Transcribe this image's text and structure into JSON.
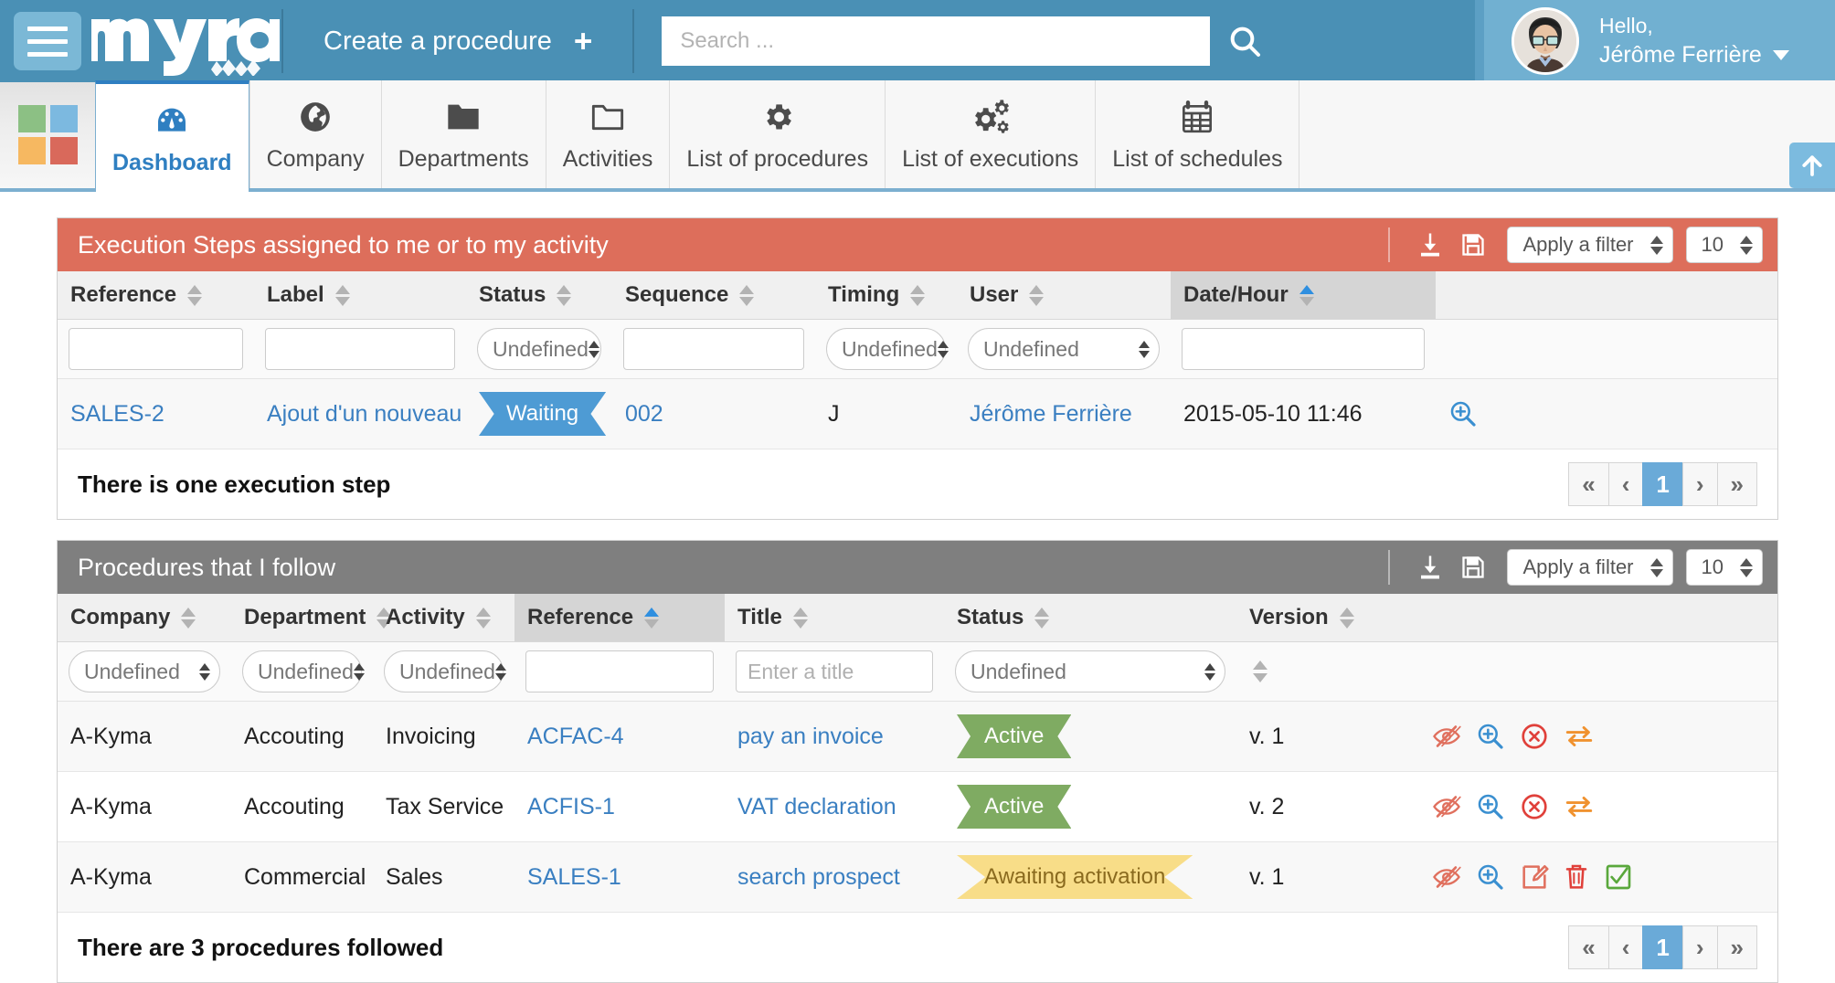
{
  "brand": {
    "name": "myra",
    "logo_squares": [
      "#8cc084",
      "#7cb9e0",
      "#f6b861",
      "#d9695b"
    ]
  },
  "topbar": {
    "menu_icon": "hamburger-icon",
    "create_label": "Create a procedure",
    "create_plus": "+",
    "search_placeholder": "Search ...",
    "search_value": "",
    "search_icon": "search-icon",
    "greeting": "Hello,",
    "user_name": "Jérôme Ferrière",
    "accent": "#4a90b5"
  },
  "nav": {
    "tabs": [
      {
        "label": "Dashboard",
        "icon": "dashboard-gauge-icon",
        "active": true
      },
      {
        "label": "Company",
        "icon": "globe-icon",
        "active": false
      },
      {
        "label": "Departments",
        "icon": "folder-filled-icon",
        "active": false
      },
      {
        "label": "Activities",
        "icon": "folder-outline-icon",
        "active": false
      },
      {
        "label": "List of procedures",
        "icon": "gear-icon",
        "active": false
      },
      {
        "label": "List of executions",
        "icon": "gears-icon",
        "active": false
      },
      {
        "label": "List of schedules",
        "icon": "calendar-icon",
        "active": false
      }
    ],
    "scroll_top_icon": "arrow-up-icon"
  },
  "panel1": {
    "title": "Execution Steps assigned to me or to my activity",
    "header_color": "#dd6e5b",
    "tools": {
      "export_icon": "download-icon",
      "save_icon": "floppy-save-icon",
      "filter_label": "Apply a filter",
      "page_size": "10"
    },
    "columns": [
      {
        "label": "Reference",
        "sort": "none"
      },
      {
        "label": "Label",
        "sort": "none"
      },
      {
        "label": "Status",
        "sort": "none"
      },
      {
        "label": "Sequence",
        "sort": "none"
      },
      {
        "label": "Timing",
        "sort": "none"
      },
      {
        "label": "User",
        "sort": "none"
      },
      {
        "label": "Date/Hour",
        "sort": "asc"
      },
      {
        "label": "",
        "sort": "none"
      }
    ],
    "filters": {
      "reference": "",
      "label": "",
      "status": "Undefined",
      "sequence": "",
      "timing": "Undefined",
      "user": "Undefined",
      "date": ""
    },
    "rows": [
      {
        "reference": "SALES-2",
        "label": "Ajout d'un nouveau client",
        "status": "Waiting",
        "status_color": "blue",
        "sequence": "002",
        "timing": "J",
        "user": "Jérôme Ferrière",
        "date": "2015-05-10 11:46",
        "action_icon": "zoom-in-icon"
      }
    ],
    "footer_text": "There is one execution step",
    "pager": {
      "first": "«",
      "prev": "‹",
      "current": "1",
      "next": "›",
      "last": "»"
    }
  },
  "panel2": {
    "title": "Procedures that I follow",
    "header_color": "#7f7f7f",
    "tools": {
      "export_icon": "download-icon",
      "save_icon": "floppy-save-icon",
      "filter_label": "Apply a filter",
      "page_size": "10"
    },
    "columns": [
      {
        "label": "Company",
        "sort": "none"
      },
      {
        "label": "Department",
        "sort": "none"
      },
      {
        "label": "Activity",
        "sort": "none"
      },
      {
        "label": "Reference",
        "sort": "asc"
      },
      {
        "label": "Title",
        "sort": "none"
      },
      {
        "label": "Status",
        "sort": "none"
      },
      {
        "label": "Version",
        "sort": "none"
      },
      {
        "label": "",
        "sort": "none"
      }
    ],
    "filters": {
      "company": "Undefined",
      "department": "Undefined",
      "activity": "Undefined",
      "reference": "",
      "title_placeholder": "Enter a title",
      "title": "",
      "status": "Undefined"
    },
    "rows": [
      {
        "company": "A-Kyma",
        "department": "Accouting",
        "activity": "Invoicing",
        "reference": "ACFAC-4",
        "title": "pay an invoice",
        "status": "Active",
        "status_color": "green",
        "version": "v. 1",
        "actions": [
          "eye-slash-icon",
          "zoom-in-icon",
          "cancel-circle-icon",
          "swap-arrows-icon"
        ]
      },
      {
        "company": "A-Kyma",
        "department": "Accouting",
        "activity": "Tax Service",
        "reference": "ACFIS-1",
        "title": "VAT declaration",
        "status": "Active",
        "status_color": "green",
        "version": "v. 2",
        "actions": [
          "eye-slash-icon",
          "zoom-in-icon",
          "cancel-circle-icon",
          "swap-arrows-icon"
        ]
      },
      {
        "company": "A-Kyma",
        "department": "Commercial",
        "activity": "Sales",
        "reference": "SALES-1",
        "title": "search prospect",
        "status": "Awaiting activation",
        "status_color": "yellow",
        "version": "v. 1",
        "actions": [
          "eye-slash-icon",
          "zoom-in-icon",
          "edit-icon",
          "trash-icon",
          "check-box-icon"
        ]
      }
    ],
    "footer_text": "There are 3 procedures followed",
    "pager": {
      "first": "«",
      "prev": "‹",
      "current": "1",
      "next": "›",
      "last": "»"
    }
  }
}
